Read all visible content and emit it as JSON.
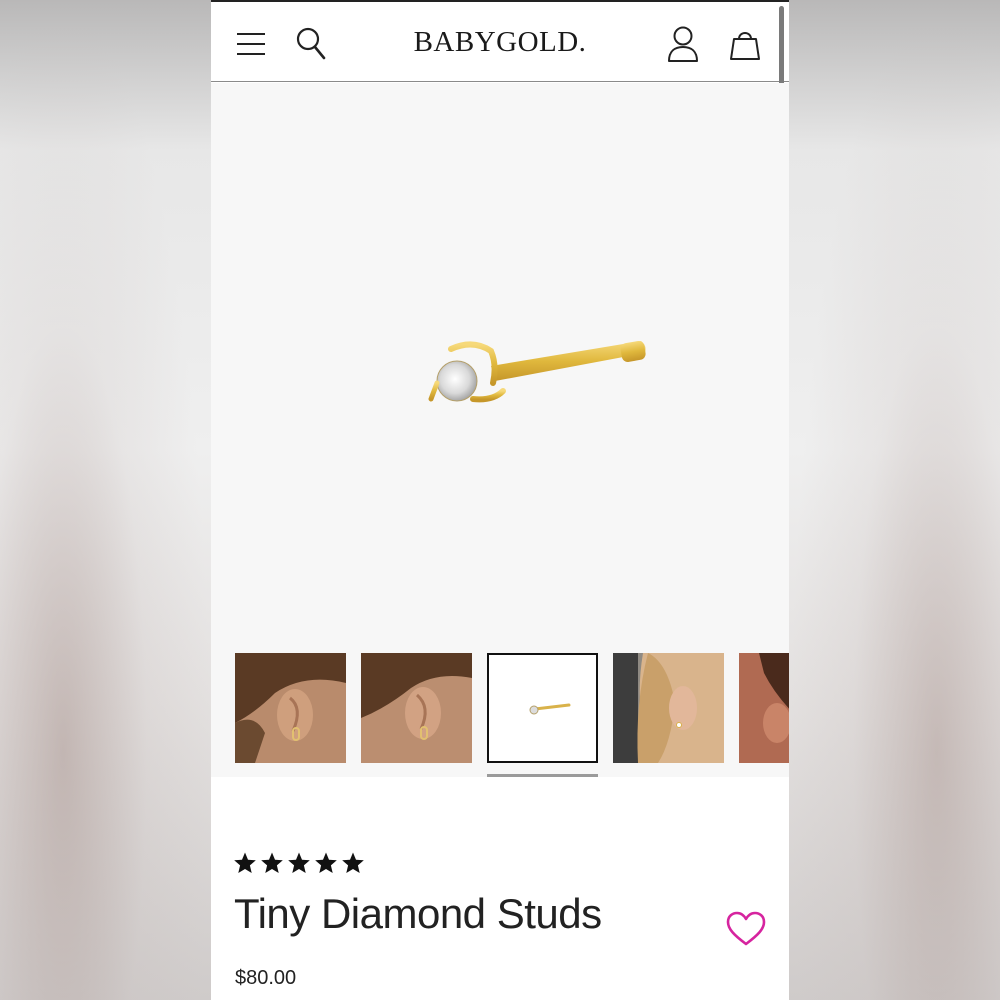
{
  "header": {
    "brand": "BABYGOLD.",
    "icons": [
      "menu-icon",
      "search-icon",
      "account-icon",
      "shopping-bag-icon"
    ]
  },
  "gallery": {
    "thumbnail_count": 5,
    "selected_index": 2
  },
  "product": {
    "rating": 5,
    "title": "Tiny Diamond Studs",
    "price": "$80.00",
    "wishlist_icon": "heart-icon",
    "wishlist_color": "#d6249f"
  }
}
